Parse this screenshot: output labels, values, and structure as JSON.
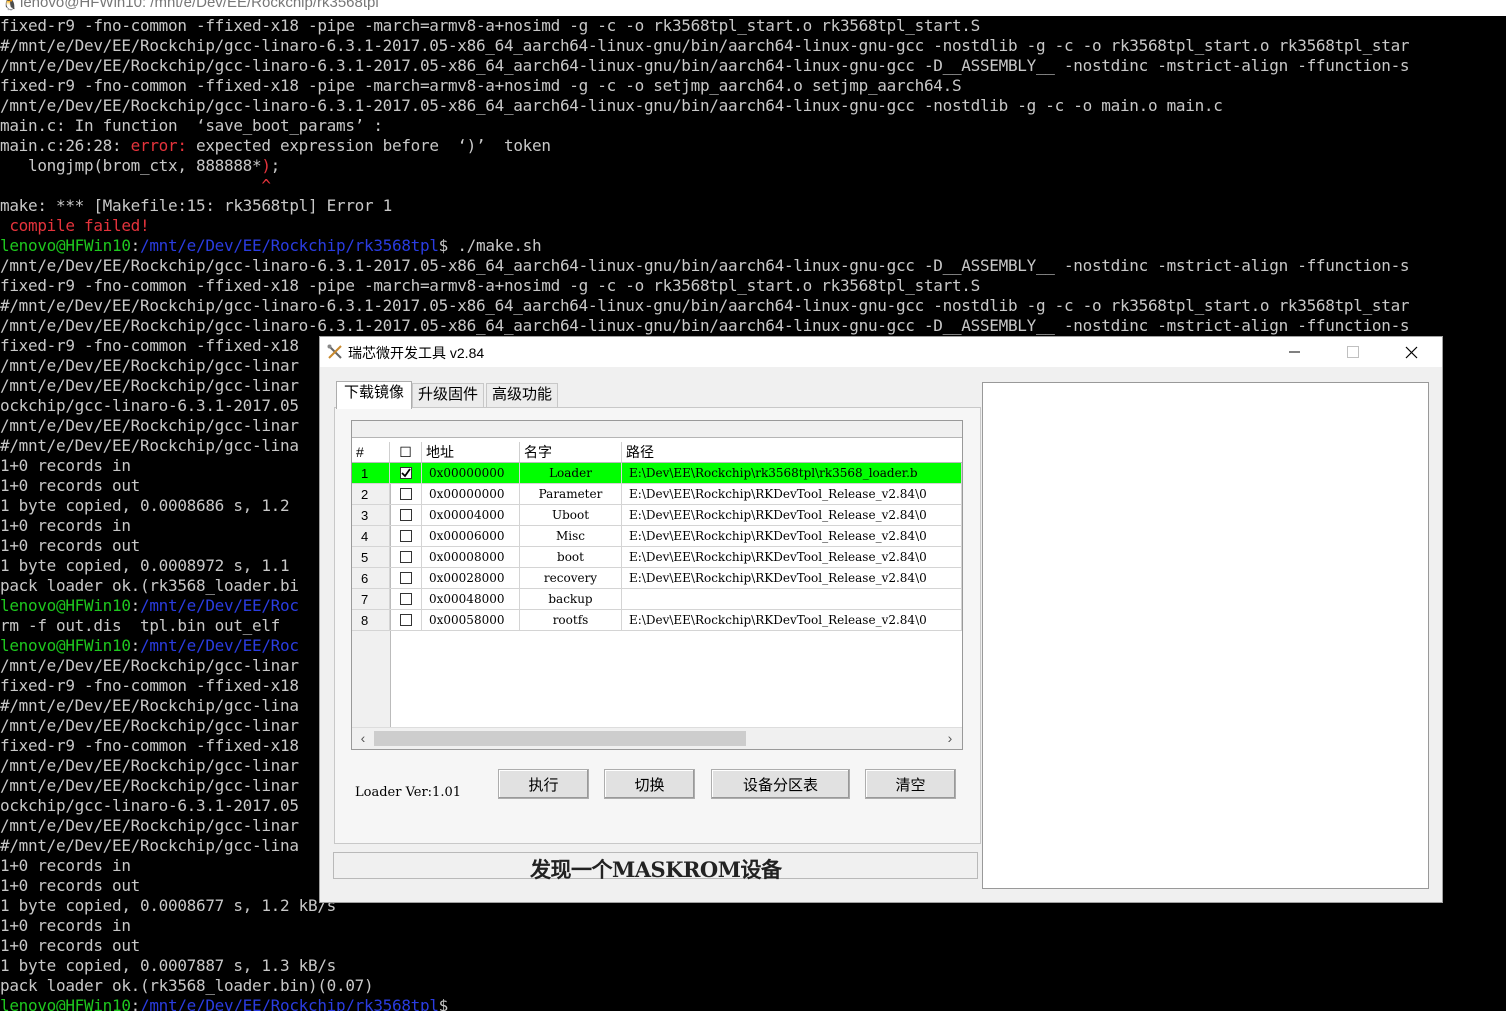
{
  "terminal": {
    "window_title": "lenovo@HFWin10: /mnt/e/Dev/EE/Rockchip/rk3568tpl",
    "lines": [
      [
        {
          "t": "fixed-r9 -fno-common -ffixed-x18 -pipe -march=armv8-a+nosimd -g -c -o rk3568tpl_start.o rk3568tpl_start.S"
        }
      ],
      [
        {
          "t": "#/mnt/e/Dev/EE/Rockchip/gcc-linaro-6.3.1-2017.05-x86_64_aarch64-linux-gnu/bin/aarch64-linux-gnu-gcc -nostdlib -g -c -o rk3568tpl_start.o rk3568tpl_star"
        }
      ],
      [
        {
          "t": "/mnt/e/Dev/EE/Rockchip/gcc-linaro-6.3.1-2017.05-x86_64_aarch64-linux-gnu/bin/aarch64-linux-gnu-gcc -D__ASSEMBLY__ -nostdinc -mstrict-align -ffunction-s"
        }
      ],
      [
        {
          "t": "fixed-r9 -fno-common -ffixed-x18 -pipe -march=armv8-a+nosimd -g -c -o setjmp_aarch64.o setjmp_aarch64.S"
        }
      ],
      [
        {
          "t": "/mnt/e/Dev/EE/Rockchip/gcc-linaro-6.3.1-2017.05-x86_64_aarch64-linux-gnu/bin/aarch64-linux-gnu-gcc -nostdlib -g -c -o main.o main.c"
        }
      ],
      [
        {
          "t": "main.c: In function  ‘save_boot_params’ :"
        }
      ],
      [
        {
          "t": "main.c:26:28: "
        },
        {
          "t": "error:",
          "c": "err"
        },
        {
          "t": " expected expression before  ‘)’  token"
        }
      ],
      [
        {
          "t": "   longjmp(brom_ctx, 888888*"
        },
        {
          "t": ")",
          "c": "err"
        },
        {
          "t": ";"
        }
      ],
      [
        {
          "t": "   "
        },
        {
          "t": "                         ^",
          "c": "err"
        }
      ],
      [
        {
          "t": "make: *** [Makefile:15: rk3568tpl] Error 1"
        }
      ],
      [
        {
          "t": " compile failed!",
          "c": "err"
        }
      ],
      [
        {
          "t": "lenovo@HFWin10",
          "c": "user"
        },
        {
          "t": ":"
        },
        {
          "t": "/mnt/e/Dev/EE/Rockchip/rk3568tpl",
          "c": "path"
        },
        {
          "t": "$ ./make.sh"
        }
      ],
      [
        {
          "t": "/mnt/e/Dev/EE/Rockchip/gcc-linaro-6.3.1-2017.05-x86_64_aarch64-linux-gnu/bin/aarch64-linux-gnu-gcc -D__ASSEMBLY__ -nostdinc -mstrict-align -ffunction-s"
        }
      ],
      [
        {
          "t": "fixed-r9 -fno-common -ffixed-x18 -pipe -march=armv8-a+nosimd -g -c -o rk3568tpl_start.o rk3568tpl_start.S"
        }
      ],
      [
        {
          "t": "#/mnt/e/Dev/EE/Rockchip/gcc-linaro-6.3.1-2017.05-x86_64_aarch64-linux-gnu/bin/aarch64-linux-gnu-gcc -nostdlib -g -c -o rk3568tpl_start.o rk3568tpl_star"
        }
      ],
      [
        {
          "t": "/mnt/e/Dev/EE/Rockchip/gcc-linaro-6.3.1-2017.05-x86_64_aarch64-linux-gnu/bin/aarch64-linux-gnu-gcc -D__ASSEMBLY__ -nostdinc -mstrict-align -ffunction-s"
        }
      ],
      [
        {
          "t": "fixed-r9 -fno-common -ffixed-x18"
        }
      ],
      [
        {
          "t": "/mnt/e/Dev/EE/Rockchip/gcc-linar                                                                                                                  tjmp_aa"
        }
      ],
      [
        {
          "t": "/mnt/e/Dev/EE/Rockchip/gcc-linar"
        }
      ],
      [
        {
          "t": "ockchip/gcc-linaro-6.3.1-2017.05"
        }
      ],
      [
        {
          "t": "/mnt/e/Dev/EE/Rockchip/gcc-linar"
        }
      ],
      [
        {
          "t": "#/mnt/e/Dev/EE/Rockchip/gcc-lina"
        }
      ],
      [
        {
          "t": "1+0 records in"
        }
      ],
      [
        {
          "t": "1+0 records out"
        }
      ],
      [
        {
          "t": "1 byte copied, 0.0008686 s, 1.2"
        }
      ],
      [
        {
          "t": "1+0 records in"
        }
      ],
      [
        {
          "t": "1+0 records out"
        }
      ],
      [
        {
          "t": "1 byte copied, 0.0008972 s, 1.1"
        }
      ],
      [
        {
          "t": "pack loader ok.(rk3568_loader.bi"
        }
      ],
      [
        {
          "t": "lenovo@HFWin10",
          "c": "user"
        },
        {
          "t": ":"
        },
        {
          "t": "/mnt/e/Dev/EE/Roc",
          "c": "path"
        }
      ],
      [
        {
          "t": "rm -f out.dis  tpl.bin out_elf"
        }
      ],
      [
        {
          "t": "lenovo@HFWin10",
          "c": "user"
        },
        {
          "t": ":"
        },
        {
          "t": "/mnt/e/Dev/EE/Roc",
          "c": "path"
        }
      ],
      [
        {
          "t": "/mnt/e/Dev/EE/Rockchip/gcc-linar                                                                                                                  ction-s"
        }
      ],
      [
        {
          "t": "fixed-r9 -fno-common -ffixed-x18"
        }
      ],
      [
        {
          "t": "#/mnt/e/Dev/EE/Rockchip/gcc-lina                                                                                                                  pl_star"
        }
      ],
      [
        {
          "t": "/mnt/e/Dev/EE/Rockchip/gcc-linar                                                                                                                  ction-s"
        }
      ],
      [
        {
          "t": "fixed-r9 -fno-common -ffixed-x18"
        }
      ],
      [
        {
          "t": "/mnt/e/Dev/EE/Rockchip/gcc-linar"
        }
      ],
      [
        {
          "t": "/mnt/e/Dev/EE/Rockchip/gcc-linar                                                                                                                  tjmp_aa"
        }
      ],
      [
        {
          "t": "ockchip/gcc-linaro-6.3.1-2017.05"
        }
      ],
      [
        {
          "t": "/mnt/e/Dev/EE/Rockchip/gcc-linar"
        }
      ],
      [
        {
          "t": "#/mnt/e/Dev/EE/Rockchip/gcc-lina"
        }
      ],
      [
        {
          "t": "1+0 records in"
        }
      ],
      [
        {
          "t": "1+0 records out"
        }
      ],
      [
        {
          "t": "1 byte copied, 0.0008677 s, 1.2 kB/s"
        }
      ],
      [
        {
          "t": "1+0 records in"
        }
      ],
      [
        {
          "t": "1+0 records out"
        }
      ],
      [
        {
          "t": "1 byte copied, 0.0007887 s, 1.3 kB/s"
        }
      ],
      [
        {
          "t": "pack loader ok.(rk3568_loader.bin)(0.07)"
        }
      ],
      [
        {
          "t": "lenovo@HFWin10",
          "c": "user"
        },
        {
          "t": ":"
        },
        {
          "t": "/mnt/e/Dev/EE/Rockchip/rk3568tpl",
          "c": "path"
        },
        {
          "t": "$"
        }
      ]
    ]
  },
  "dialog": {
    "title": "瑞芯微开发工具 v2.84",
    "tabs": [
      "下载镜像",
      "升级固件",
      "高级功能"
    ],
    "active_tab": 0,
    "grid": {
      "headers": {
        "index": "#",
        "check": "☐",
        "address": "地址",
        "name": "名字",
        "path": "路径"
      },
      "rows": [
        {
          "index": "1",
          "checked": true,
          "address": "0x00000000",
          "name": "Loader",
          "path": "E:\\Dev\\EE\\Rockchip\\rk3568tpl\\rk3568_loader.b",
          "selected": true
        },
        {
          "index": "2",
          "checked": false,
          "address": "0x00000000",
          "name": "Parameter",
          "path": "E:\\Dev\\EE\\Rockchip\\RKDevTool_Release_v2.84\\0"
        },
        {
          "index": "3",
          "checked": false,
          "address": "0x00004000",
          "name": "Uboot",
          "path": "E:\\Dev\\EE\\Rockchip\\RKDevTool_Release_v2.84\\0"
        },
        {
          "index": "4",
          "checked": false,
          "address": "0x00006000",
          "name": "Misc",
          "path": "E:\\Dev\\EE\\Rockchip\\RKDevTool_Release_v2.84\\0"
        },
        {
          "index": "5",
          "checked": false,
          "address": "0x00008000",
          "name": "boot",
          "path": "E:\\Dev\\EE\\Rockchip\\RKDevTool_Release_v2.84\\0"
        },
        {
          "index": "6",
          "checked": false,
          "address": "0x00028000",
          "name": "recovery",
          "path": "E:\\Dev\\EE\\Rockchip\\RKDevTool_Release_v2.84\\0"
        },
        {
          "index": "7",
          "checked": false,
          "address": "0x00048000",
          "name": "backup",
          "path": ""
        },
        {
          "index": "8",
          "checked": false,
          "address": "0x00058000",
          "name": "rootfs",
          "path": "E:\\Dev\\EE\\Rockchip\\RKDevTool_Release_v2.84\\0"
        }
      ]
    },
    "loader_ver": "Loader Ver:1.01",
    "buttons": {
      "run": "执行",
      "switch": "切换",
      "partition_table": "设备分区表",
      "clear": "清空"
    },
    "status": "发现一个MASKROM设备",
    "colors": {
      "selected_row": "#00ff00",
      "error_text": "#e5333c",
      "prompt_user": "#1ec81e",
      "prompt_path": "#2a3ce0"
    }
  }
}
